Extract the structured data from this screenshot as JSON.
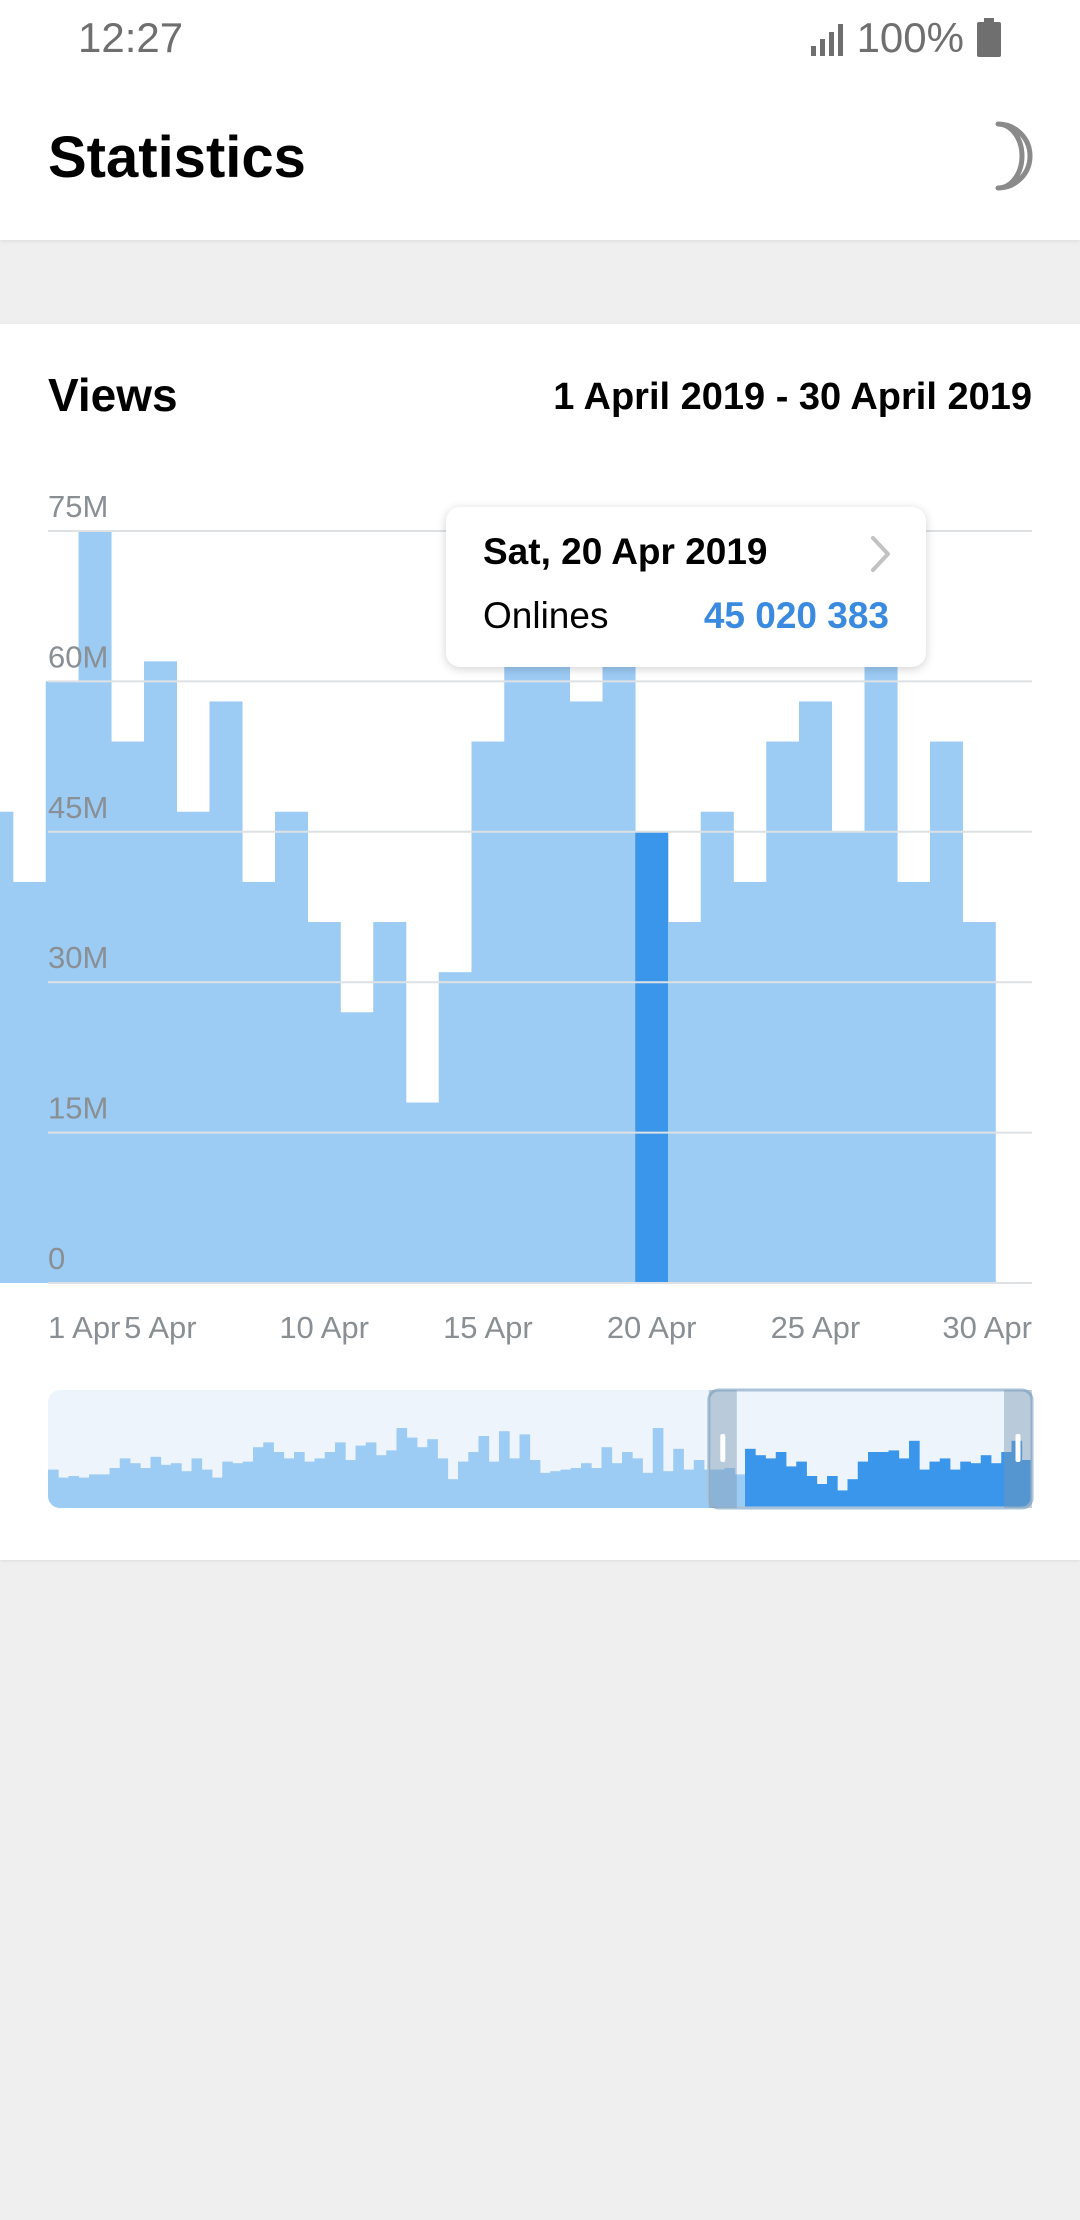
{
  "status_bar": {
    "time": "12:27",
    "battery": "100%"
  },
  "app_bar": {
    "title": "Statistics",
    "night_mode_icon": "moon-icon"
  },
  "card": {
    "title": "Views",
    "range": "1 April 2019 - 30 April 2019"
  },
  "tooltip": {
    "date": "Sat, 20 Apr 2019",
    "label": "Onlines",
    "value": "45 020 383",
    "chevron_icon": "chevron-right-icon"
  },
  "colors": {
    "bar": "#9ccbf4",
    "bar_selected": "#3a96ea",
    "value_text": "#3a8ae0",
    "grid": "#dde1e4",
    "axis_text": "#8a8f94"
  },
  "chart_data": {
    "type": "bar",
    "x": [
      "31 Mar",
      "1 Apr",
      "2 Apr",
      "3 Apr",
      "4 Apr",
      "5 Apr",
      "6 Apr",
      "7 Apr",
      "8 Apr",
      "9 Apr",
      "10 Apr",
      "11 Apr",
      "12 Apr",
      "13 Apr",
      "14 Apr",
      "15 Apr",
      "16 Apr",
      "17 Apr",
      "18 Apr",
      "19 Apr",
      "20 Apr",
      "21 Apr",
      "22 Apr",
      "23 Apr",
      "24 Apr",
      "25 Apr",
      "26 Apr",
      "27 Apr",
      "28 Apr",
      "29 Apr",
      "30 Apr"
    ],
    "values": [
      47000000,
      40000000,
      60000000,
      75000000,
      54000000,
      62000000,
      47000000,
      58000000,
      40000000,
      47000000,
      36000000,
      27000000,
      36000000,
      18000000,
      31000000,
      54000000,
      62000000,
      62000000,
      58000000,
      62000000,
      45020383,
      36000000,
      47000000,
      40000000,
      54000000,
      58000000,
      45000000,
      70000000,
      40000000,
      54000000,
      36000000
    ],
    "first_bar_value": 62000000,
    "selected_index": 20,
    "yticks": [
      "0",
      "15M",
      "30M",
      "45M",
      "60M",
      "75M"
    ],
    "ytick_values": [
      0,
      15000000,
      30000000,
      45000000,
      60000000,
      75000000
    ],
    "ylim": [
      0,
      75000000
    ],
    "xtick_labels": [
      "1 Apr",
      "5 Apr",
      "10 Apr",
      "15 Apr",
      "20 Apr",
      "25 Apr",
      "30 Apr"
    ],
    "xtick_days": [
      1,
      5,
      10,
      15,
      20,
      25,
      30
    ],
    "overview": {
      "values": [
        0.48,
        0.38,
        0.4,
        0.38,
        0.42,
        0.42,
        0.5,
        0.62,
        0.56,
        0.5,
        0.64,
        0.54,
        0.56,
        0.46,
        0.62,
        0.48,
        0.38,
        0.58,
        0.56,
        0.58,
        0.76,
        0.82,
        0.7,
        0.62,
        0.7,
        0.58,
        0.62,
        0.7,
        0.82,
        0.6,
        0.78,
        0.82,
        0.66,
        0.72,
        1.0,
        0.88,
        0.76,
        0.86,
        0.62,
        0.36,
        0.58,
        0.7,
        0.9,
        0.58,
        0.96,
        0.62,
        0.92,
        0.6,
        0.44,
        0.46,
        0.48,
        0.5,
        0.56,
        0.5,
        0.76,
        0.56,
        0.7,
        0.62,
        0.44,
        1.0,
        0.46,
        0.74,
        0.48,
        0.6,
        0.48,
        0.48,
        0.5,
        0.42,
        0.74,
        0.66,
        0.62,
        0.7,
        0.52,
        0.58,
        0.4,
        0.3,
        0.4,
        0.22,
        0.36,
        0.58,
        0.7,
        0.7,
        0.72,
        0.62,
        0.84,
        0.48,
        0.58,
        0.62,
        0.48,
        0.58,
        0.56,
        0.66,
        0.56,
        0.7,
        0.84,
        0.6
      ],
      "selection_start": 0.7,
      "selection_end": 1.0
    }
  }
}
